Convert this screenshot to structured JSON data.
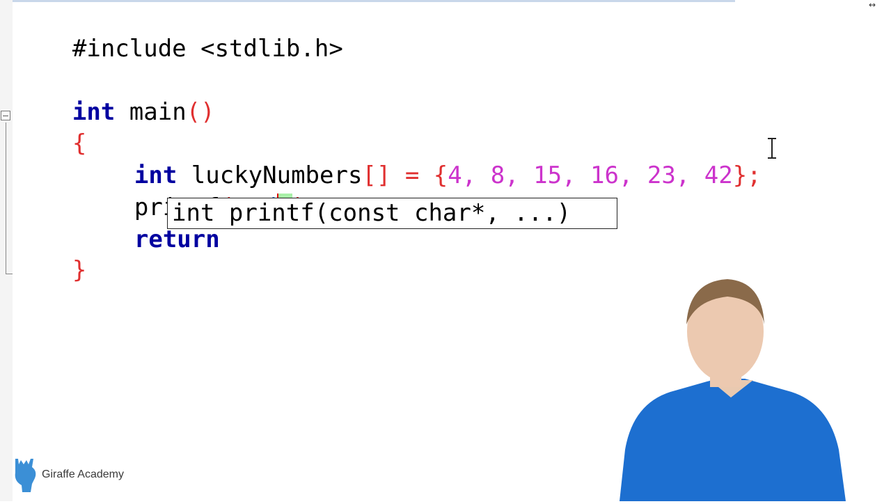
{
  "editor": {
    "lines": [
      {
        "id": "l1",
        "text": "#include <stdlib.h>"
      },
      {
        "id": "l3_kw",
        "text": "int"
      },
      {
        "id": "l3_rest",
        "text": " main"
      },
      {
        "id": "l3_paren",
        "text": "()"
      },
      {
        "id": "l4",
        "text": "{"
      },
      {
        "id": "l5_kw",
        "text": "int"
      },
      {
        "id": "l5_name",
        "text": " luckyNumbers"
      },
      {
        "id": "l5_brk",
        "text": "[]"
      },
      {
        "id": "l5_eq",
        "text": " = "
      },
      {
        "id": "l5_open",
        "text": "{"
      },
      {
        "id": "l5_nums",
        "text": "4, 8, 15, 16, 23, 42"
      },
      {
        "id": "l5_close",
        "text": "};"
      },
      {
        "id": "l6_fn",
        "text": "printf"
      },
      {
        "id": "l6_open",
        "text": "("
      },
      {
        "id": "l6_q1",
        "text": "\""
      },
      {
        "id": "l6_fmt",
        "text": "%d"
      },
      {
        "id": "l6_q2",
        "text": "\""
      },
      {
        "id": "l6_close",
        "text": ")"
      },
      {
        "id": "l7_kw",
        "text": "return"
      },
      {
        "id": "l8",
        "text": "}"
      }
    ]
  },
  "tooltip": {
    "signature": "int printf(const char*, ...)"
  },
  "brand": {
    "name": "Giraffe Academy"
  },
  "colors": {
    "keyword": "#0000a0",
    "bracket": "#e03030",
    "number": "#cc33cc",
    "format": "#3a6fd8"
  }
}
